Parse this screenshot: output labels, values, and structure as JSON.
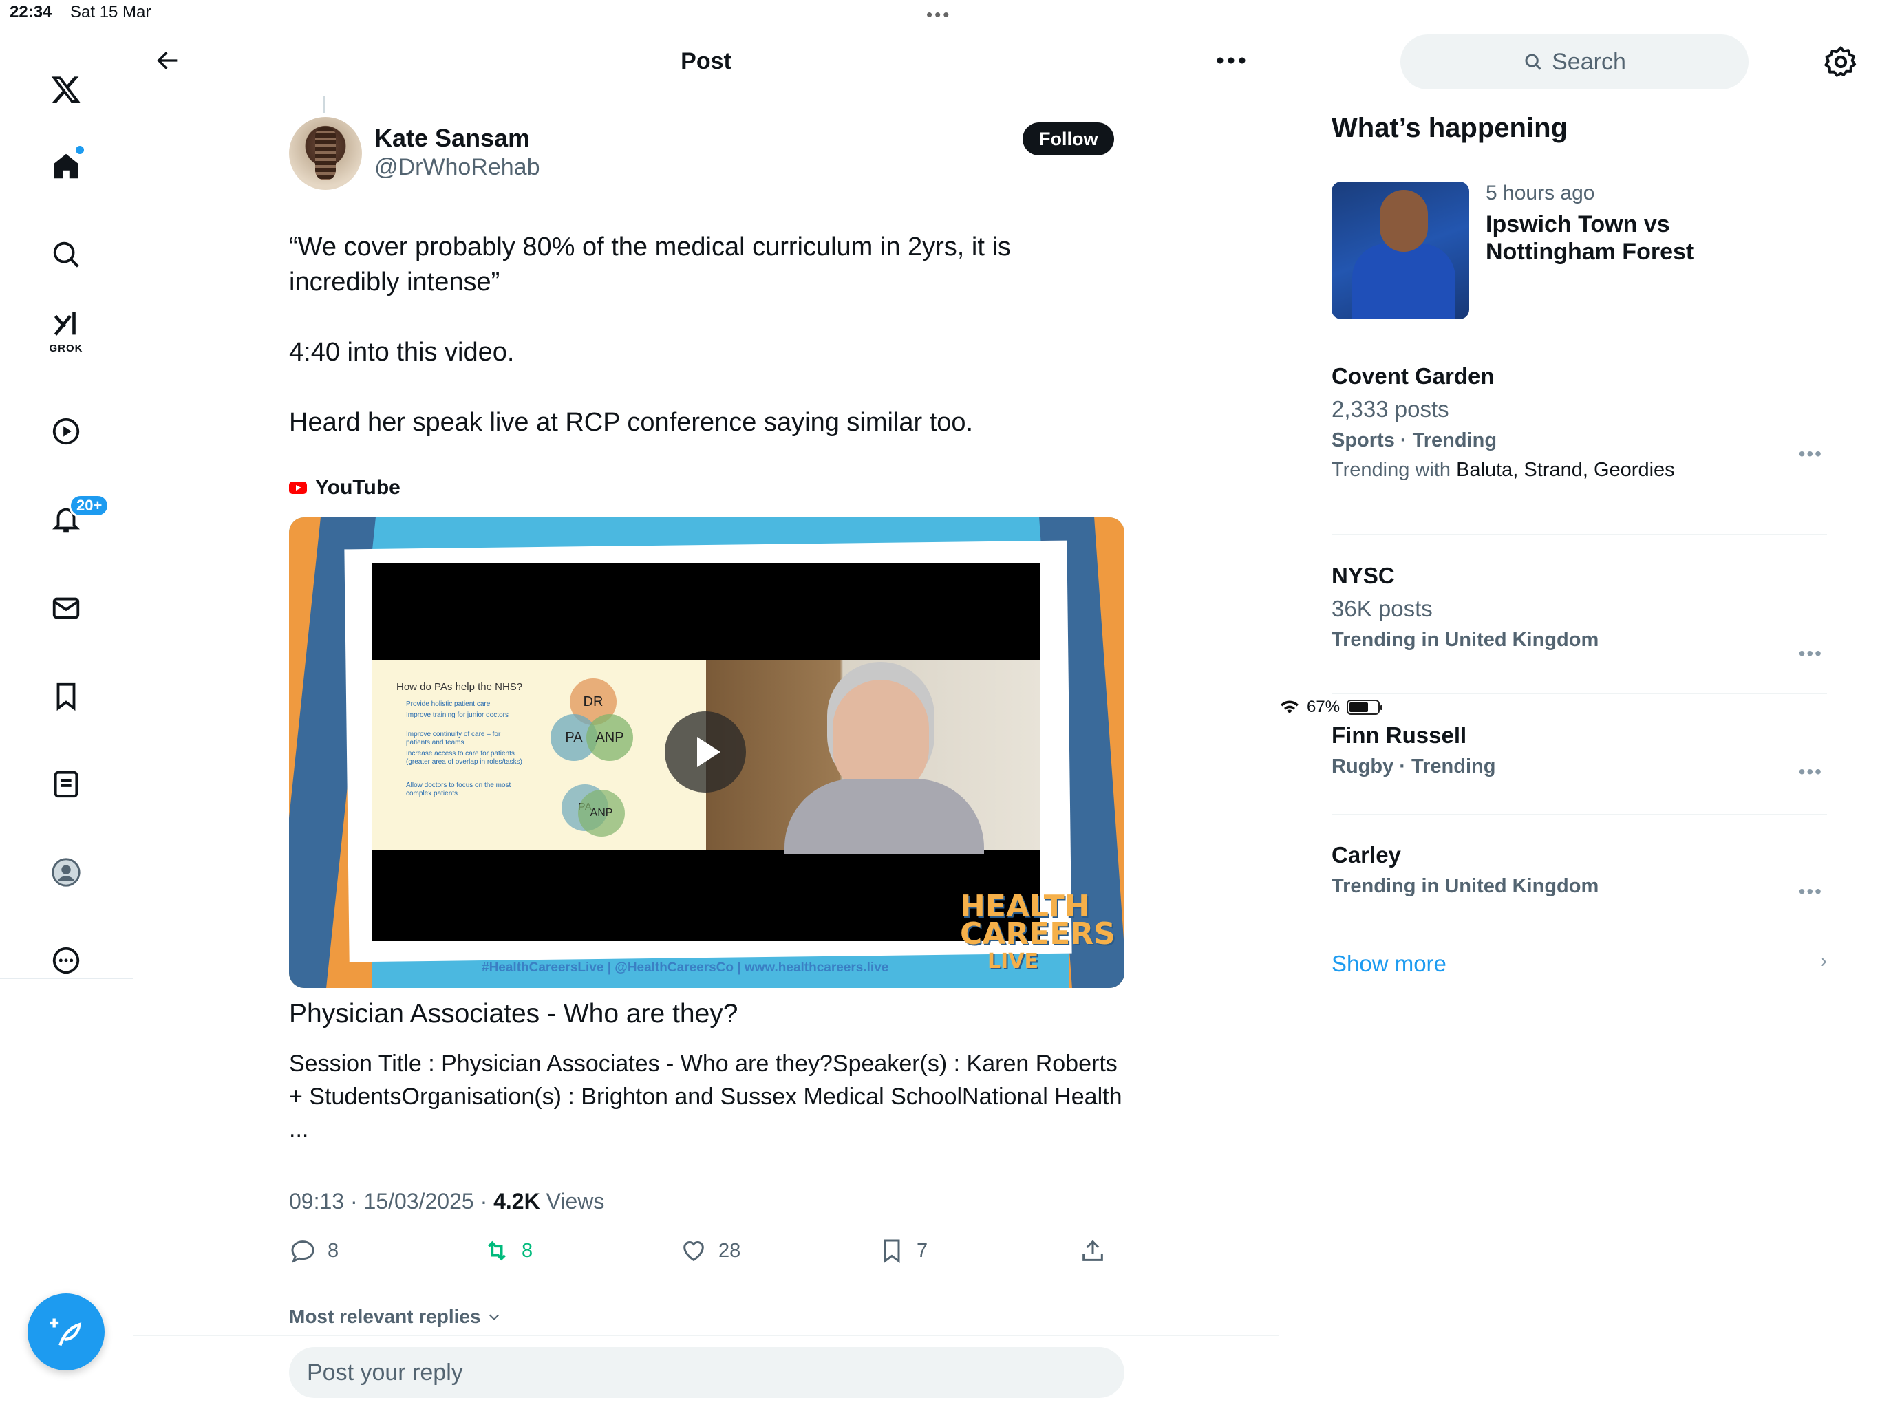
{
  "status": {
    "time": "22:34",
    "date": "Sat 15 Mar",
    "battery": "67%",
    "battery_level": 0.67
  },
  "nav": {
    "grok_label": "GROK",
    "notif_badge": "20+"
  },
  "header": {
    "title": "Post"
  },
  "post": {
    "author_name": "Kate Sansam",
    "author_handle": "@DrWhoRehab",
    "follow_label": "Follow",
    "paragraphs": [
      "“We cover probably 80% of the medical curriculum in 2yrs, it is incredibly intense”",
      "4:40 into this video.",
      "Heard her speak live at RCP conference saying similar too."
    ],
    "source": "YouTube",
    "video": {
      "slide_title": "How do PAs help the NHS?",
      "bullets": [
        "Provide holistic patient care",
        "Improve training for junior doctors",
        "Improve continuity of care – for patients and teams",
        "Increase access to care for patients (greater area of overlap in roles/tasks)",
        "Allow doctors to focus on the most complex patients"
      ],
      "circles": [
        "DR",
        "PA",
        "ANP",
        "PA",
        "ANP",
        "DR"
      ],
      "footer": "#HealthCareersLive  |  @HealthCareersCo  |  www.healthcareers.live",
      "brand": [
        "HEALTH",
        "CAREERS",
        "LIVE"
      ]
    },
    "card_title": "Physician Associates - Who are they?",
    "card_desc": "Session Title : Physician Associates - Who are they?Speaker(s) : Karen Roberts + StudentsOrganisation(s) : Brighton and Sussex Medical SchoolNational Health ...",
    "timestamp": "09:13 · 15/03/2025 · ",
    "views_count": "4.2K",
    "views_label": " Views",
    "actions": {
      "replies": "8",
      "reposts": "8",
      "likes": "28",
      "bookmarks": "7"
    },
    "replies_sort": "Most relevant replies",
    "reply_placeholder": "Post your reply"
  },
  "sidebar": {
    "search_placeholder": "Search",
    "section_title": "What’s happening",
    "news": {
      "time": "5 hours ago",
      "title": "Ipswich Town vs Nottingham Forest"
    },
    "trends": [
      {
        "name": "Covent Garden",
        "posts": "2,333 posts",
        "category": "Sports · Trending",
        "with_label": "Trending with ",
        "with_names": "Baluta, Strand, Geordies"
      },
      {
        "name": "NYSC",
        "posts": "36K posts",
        "category": "Trending in United Kingdom"
      },
      {
        "name": "Finn Russell",
        "category": "Rugby · Trending"
      },
      {
        "name": "Carley",
        "category": "Trending in United Kingdom"
      }
    ],
    "show_more": "Show more"
  },
  "colors": {
    "accent": "#1d9bf0",
    "repost_green": "#00ba7c",
    "text": "#0f1419",
    "muted": "#536471"
  }
}
